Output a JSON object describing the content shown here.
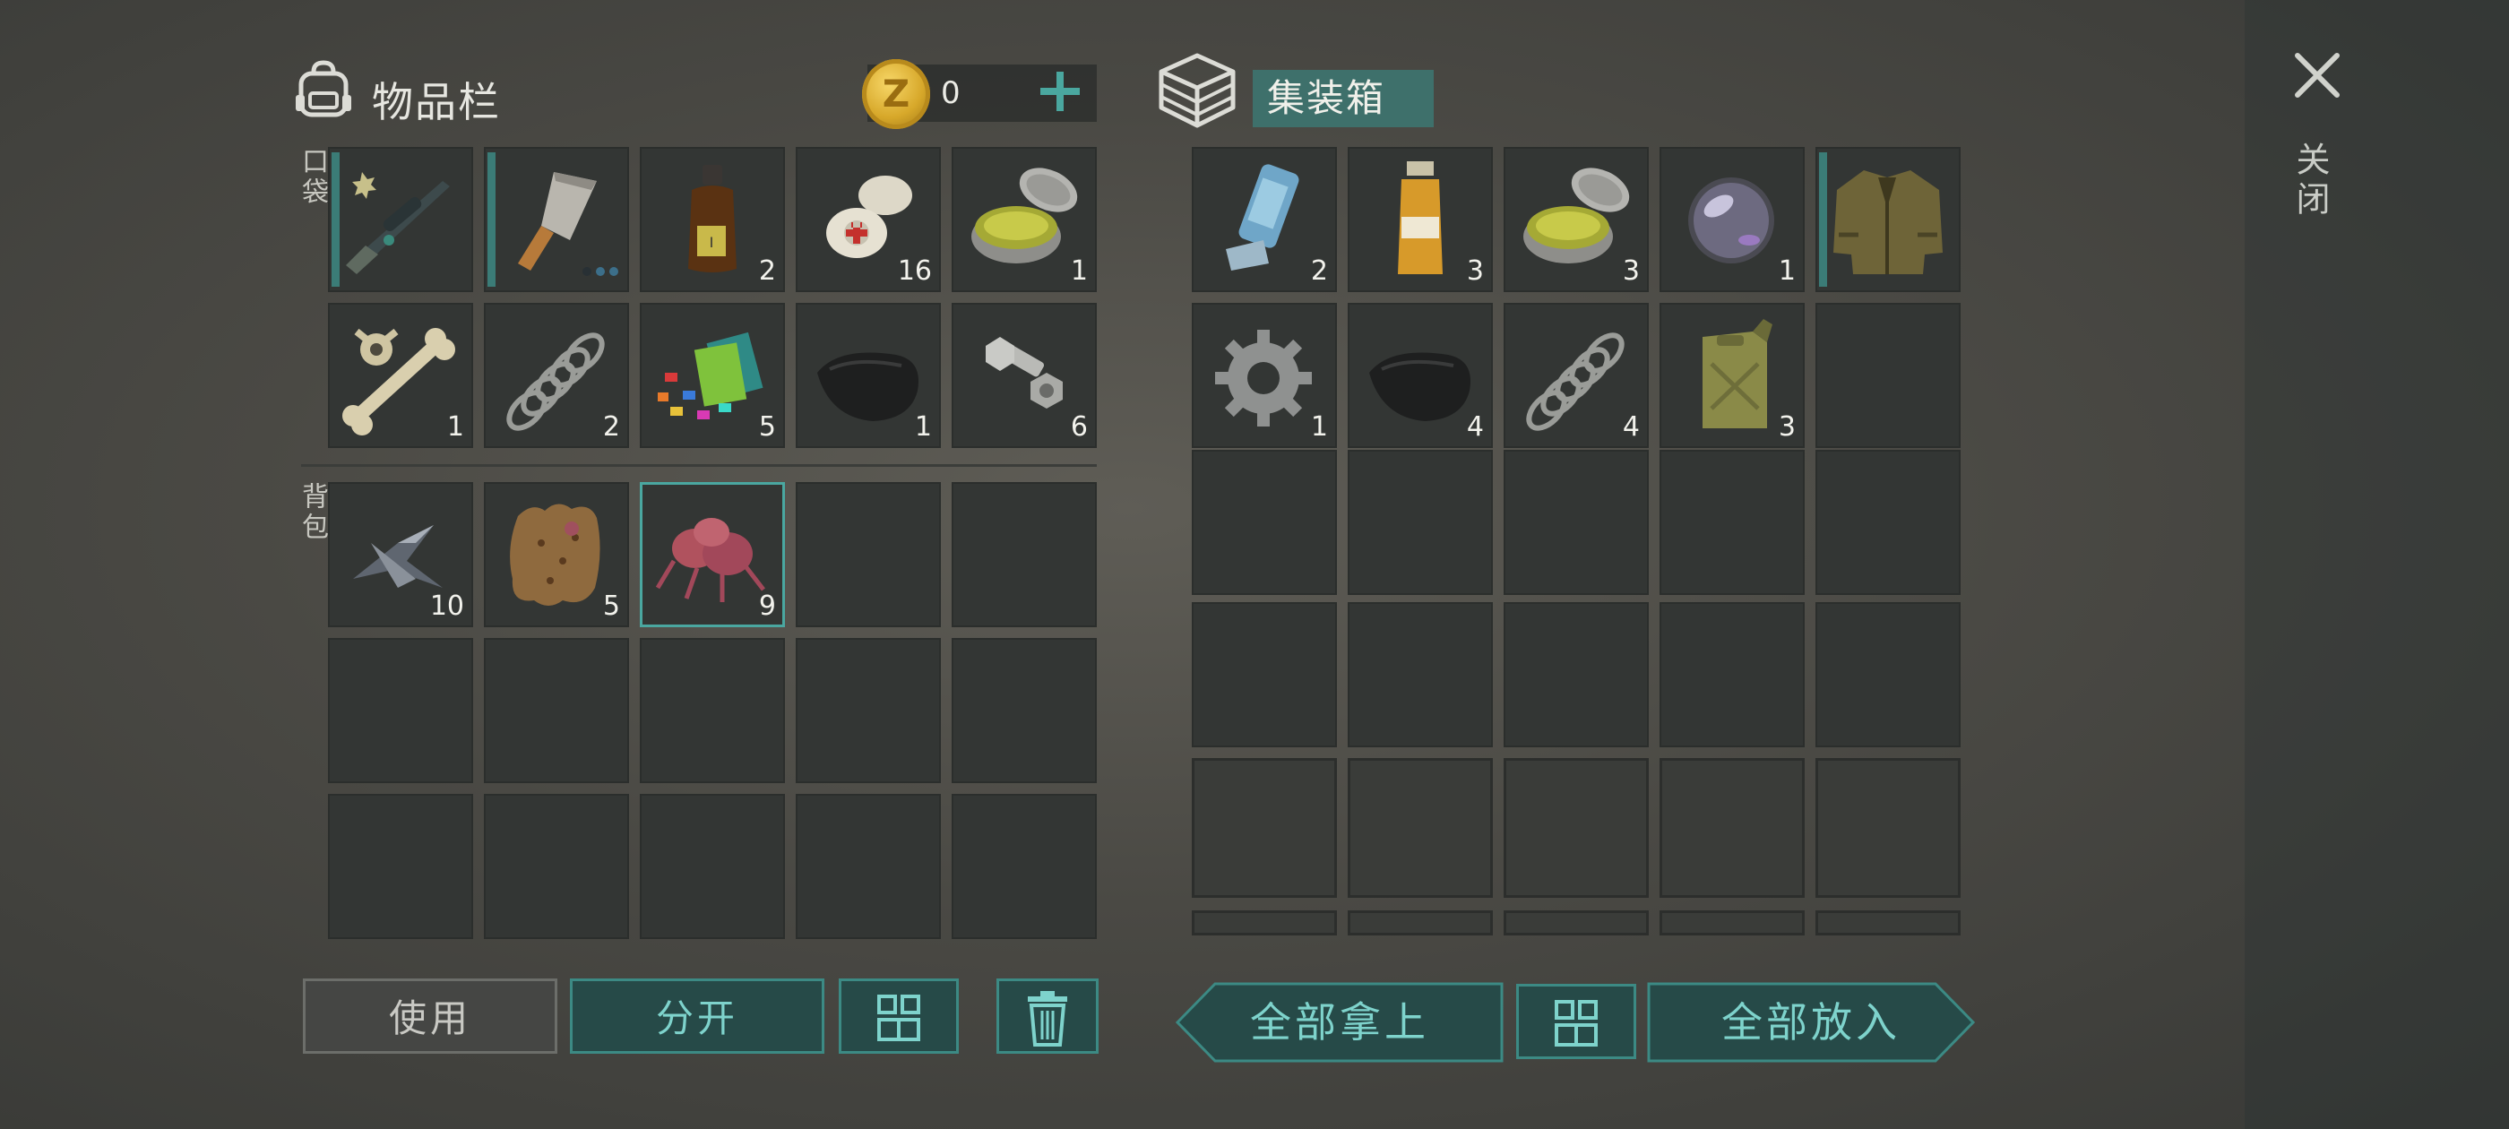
{
  "inventory": {
    "title": "物品栏",
    "coins": "0"
  },
  "container": {
    "title": "集装箱"
  },
  "close_label": "关闭",
  "labels": {
    "pocket": "口袋",
    "backpack": "背包"
  },
  "pocket_items": [
    {
      "name": "sniper-rifle",
      "count": ""
    },
    {
      "name": "cleaver",
      "count": ""
    },
    {
      "name": "iodine-bottle",
      "count": "2"
    },
    {
      "name": "bandage",
      "count": "16"
    },
    {
      "name": "ointment-jar",
      "count": "1"
    },
    {
      "name": "bones",
      "count": "1"
    },
    {
      "name": "spring",
      "count": "2"
    },
    {
      "name": "cloth-scraps",
      "count": "5"
    },
    {
      "name": "leather",
      "count": "1"
    },
    {
      "name": "nut-bolt",
      "count": "6"
    }
  ],
  "backpack_items": [
    {
      "name": "scrap-metal",
      "count": "10"
    },
    {
      "name": "animal-hide",
      "count": "5"
    },
    {
      "name": "mutant-organ",
      "count": "9"
    }
  ],
  "container_items": [
    {
      "name": "inhaler",
      "count": "2"
    },
    {
      "name": "antibiotic-bottle",
      "count": "3"
    },
    {
      "name": "ointment-jar",
      "count": "3"
    },
    {
      "name": "lens",
      "count": "1"
    },
    {
      "name": "jacket",
      "count": ""
    },
    {
      "name": "gear",
      "count": "1"
    },
    {
      "name": "leather",
      "count": "4"
    },
    {
      "name": "spring",
      "count": "4"
    },
    {
      "name": "jerrycan",
      "count": "3"
    }
  ],
  "buttons": {
    "use": "使用",
    "split": "分开",
    "take_all": "全部拿上",
    "put_all": "全部放入"
  },
  "colors": {
    "accent": "#3c8a84",
    "accent_text": "#7ed3cc",
    "selected": "#4aa7a0"
  }
}
